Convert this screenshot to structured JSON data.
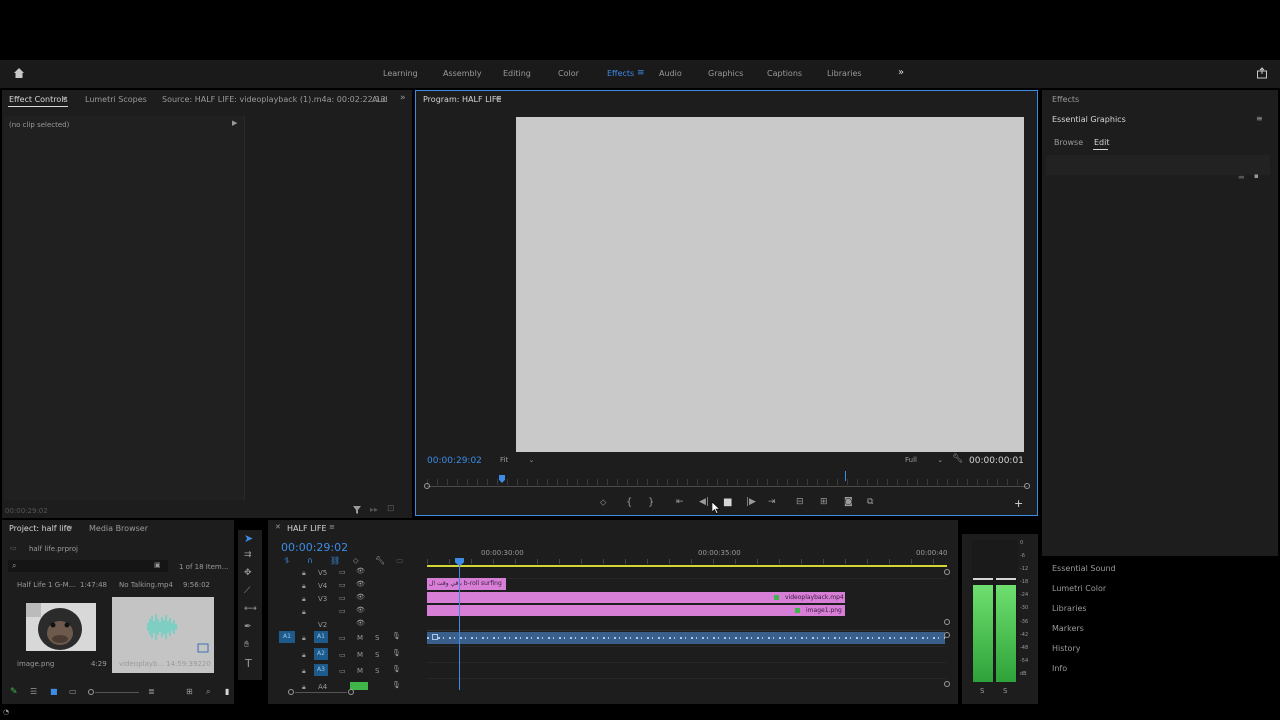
{
  "workspaces": {
    "tabs": [
      "Learning",
      "Assembly",
      "Editing",
      "Color",
      "Effects",
      "Audio",
      "Graphics",
      "Captions",
      "Libraries"
    ],
    "active": "Effects"
  },
  "left_panel": {
    "tabs": [
      "Effect Controls",
      "Lumetri Scopes",
      "Source: HALF LIFE: videoplayback (1).m4a: 00:02:22:13",
      "Aud"
    ],
    "no_clip": "(no clip selected)",
    "timecode": "00:00:29:02"
  },
  "program": {
    "title": "Program: HALF LIFE",
    "timecode": "00:00:29:02",
    "fit": "Fit",
    "quality": "Full",
    "duration": "00:00:00:01"
  },
  "right_panel": {
    "effects_label": "Effects",
    "essential_graphics": "Essential Graphics",
    "tabs": [
      "Browse",
      "Edit"
    ],
    "bottom_items": [
      "Essential Sound",
      "Lumetri Color",
      "Libraries",
      "Markers",
      "History",
      "Info"
    ]
  },
  "project": {
    "tabs": [
      "Project: half life",
      "Media Browser"
    ],
    "file": "half life.prproj",
    "count": "1 of 18 Item...",
    "items": [
      {
        "title": "Half Life 1 G-M...",
        "duration": "1:47:48",
        "name": "image.png",
        "extra": "4:29"
      },
      {
        "title": "No Talking.mp4",
        "duration": "9:56:02",
        "name": "videoplayb...",
        "extra": "14:59:39220"
      }
    ]
  },
  "timeline": {
    "title": "HALF LIFE",
    "timecode": "00:00:29:02",
    "ruler": [
      "00:00:30:00",
      "00:00:35:00",
      "00:00:40"
    ],
    "tracks_video": [
      "V5",
      "V4",
      "V3",
      "V2"
    ],
    "tracks_audio": [
      "A1",
      "A2",
      "A3",
      "A4"
    ],
    "clip_title": "باقي وقت ال b-roll surfing",
    "clip_video": "videoplayback.mp4",
    "clip_image": "image1.png"
  },
  "meter": {
    "labels": [
      "0",
      "-6",
      "-12",
      "-18",
      "-24",
      "-30",
      "-36",
      "-42",
      "-48",
      "-54",
      "dB"
    ],
    "solo": [
      "S",
      "S"
    ]
  },
  "colors": {
    "accent": "#3c8ce6",
    "clip_pink": "#d77fd7",
    "meter_green": "#3fb54a",
    "monitor_bg": "#c9c9c9"
  }
}
